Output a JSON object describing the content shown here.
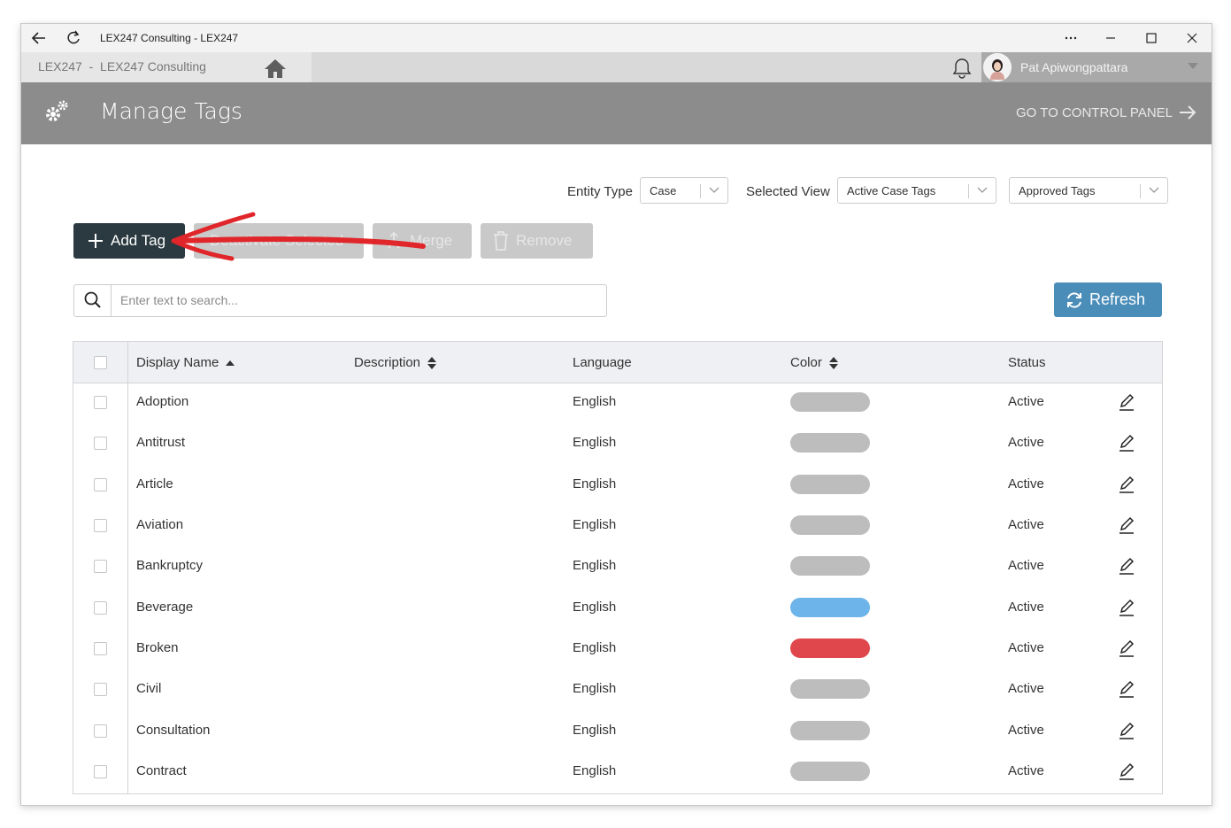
{
  "window": {
    "title": "LEX247 Consulting - LEX247"
  },
  "appbar": {
    "breadcrumb": "LEX247  -  LEX247 Consulting",
    "user_name": "Pat Apiwongpattara"
  },
  "header": {
    "title": "Manage Tags",
    "control_panel_link": "GO TO CONTROL PANEL"
  },
  "filters": {
    "entity_type_label": "Entity Type",
    "entity_type_value": "Case",
    "selected_view_label": "Selected View",
    "selected_view_value": "Active Case Tags",
    "approval_value": "Approved Tags"
  },
  "toolbar": {
    "add_label": "Add Tag",
    "deactivate_label": "Deactivate Selected",
    "merge_label": "Merge",
    "remove_label": "Remove",
    "refresh_label": "Refresh"
  },
  "search": {
    "placeholder": "Enter text to search..."
  },
  "table": {
    "columns": [
      "Display Name",
      "Description",
      "Language",
      "Color",
      "Status"
    ],
    "rows": [
      {
        "name": "Adoption",
        "language": "English",
        "color": "#bdbdbd",
        "status": "Active"
      },
      {
        "name": "Antitrust",
        "language": "English",
        "color": "#bdbdbd",
        "status": "Active"
      },
      {
        "name": "Article",
        "language": "English",
        "color": "#bdbdbd",
        "status": "Active"
      },
      {
        "name": "Aviation",
        "language": "English",
        "color": "#bdbdbd",
        "status": "Active"
      },
      {
        "name": "Bankruptcy",
        "language": "English",
        "color": "#bdbdbd",
        "status": "Active"
      },
      {
        "name": "Beverage",
        "language": "English",
        "color": "#6cb4ea",
        "status": "Active"
      },
      {
        "name": "Broken",
        "language": "English",
        "color": "#e0474c",
        "status": "Active"
      },
      {
        "name": "Civil",
        "language": "English",
        "color": "#bdbdbd",
        "status": "Active"
      },
      {
        "name": "Consultation",
        "language": "English",
        "color": "#bdbdbd",
        "status": "Active"
      },
      {
        "name": "Contract",
        "language": "English",
        "color": "#bdbdbd",
        "status": "Active"
      }
    ]
  },
  "colors": {
    "header_bg": "#8c8c8c",
    "add_button": "#2b3a40",
    "refresh_button": "#4a8db8",
    "annotation_arrow": "#e0262a"
  }
}
